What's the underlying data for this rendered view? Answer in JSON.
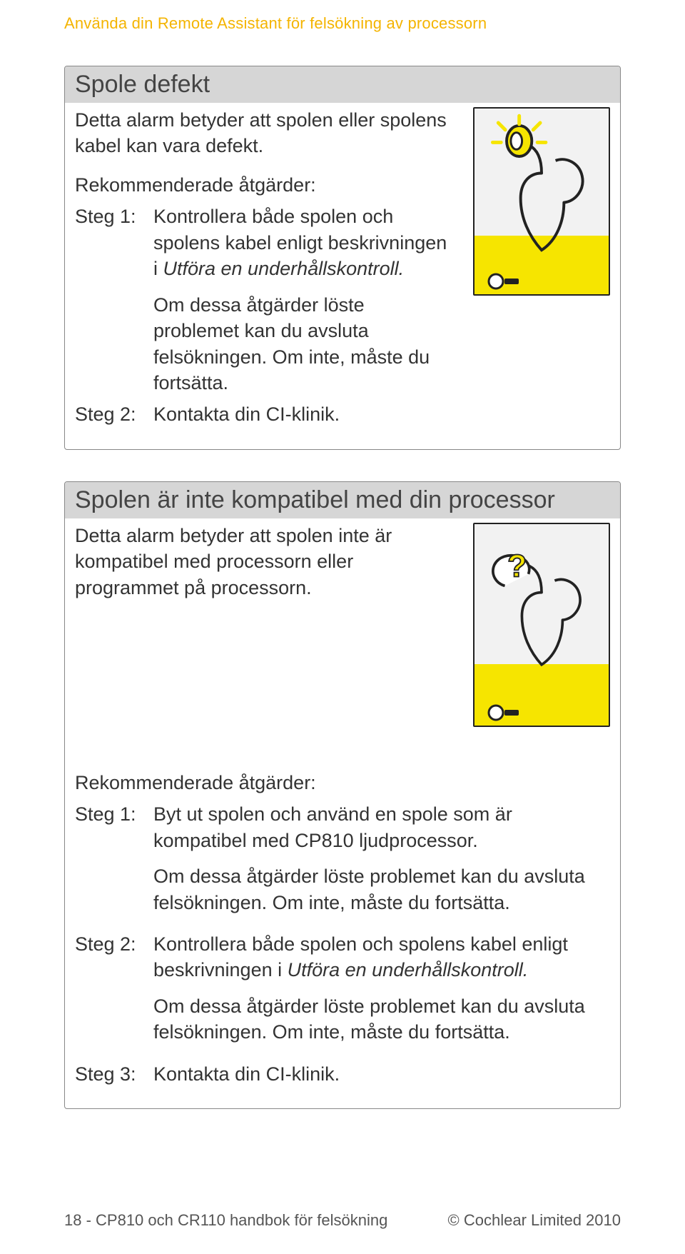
{
  "header": "Använda din Remote Assistant för felsökning av processorn",
  "sections": [
    {
      "title": "Spole defekt",
      "intro": "Detta alarm betyder att spolen eller spolens kabel kan vara defekt.",
      "subhead": "Rekommenderade åtgärder:",
      "steps": [
        {
          "label": "Steg 1:",
          "text": "Kontrollera både spolen och spolens kabel enligt beskrivningen i ",
          "italic": "Utföra en underhållskontroll.",
          "note": "Om dessa åtgärder löste problemet kan du avsluta felsökningen. Om inte, måste du fortsätta."
        },
        {
          "label": "Steg 2:",
          "text": "Kontakta din CI-klinik."
        }
      ]
    },
    {
      "title": "Spolen är inte kompatibel med din processor",
      "intro": "Detta alarm betyder att spolen inte är kompatibel med processorn eller programmet på processorn.",
      "subhead": "Rekommenderade åtgärder:",
      "steps": [
        {
          "label": "Steg 1:",
          "text": "Byt ut spolen och använd en spole som är kompatibel med CP810 ljudprocessor.",
          "note": "Om dessa åtgärder löste problemet kan du avsluta felsökningen. Om inte, måste du fortsätta."
        },
        {
          "label": "Steg 2:",
          "text": "Kontrollera både spolen och spolens kabel enligt beskrivningen i ",
          "italic": "Utföra en underhållskontroll.",
          "note": "Om dessa åtgärder löste problemet kan du avsluta felsökningen. Om inte, måste du fortsätta."
        },
        {
          "label": "Steg 3:",
          "text": "Kontakta din CI-klinik."
        }
      ]
    }
  ],
  "footer": {
    "left": "18 - CP810 och CR110 handbok för felsökning",
    "right": "© Cochlear Limited 2010"
  }
}
